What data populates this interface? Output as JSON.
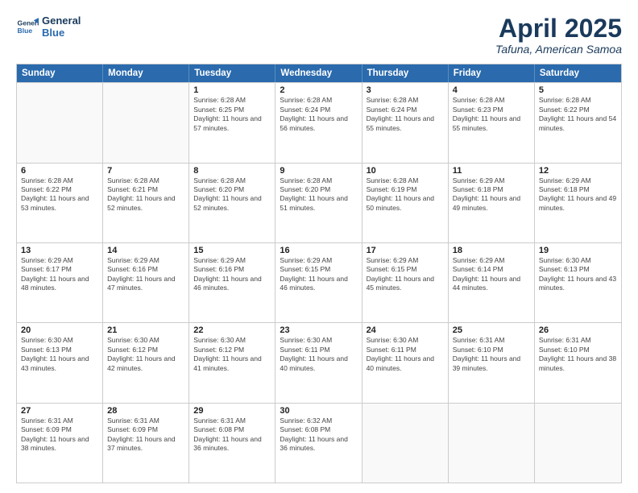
{
  "header": {
    "logo_line1": "General",
    "logo_line2": "Blue",
    "month_title": "April 2025",
    "location": "Tafuna, American Samoa"
  },
  "calendar": {
    "weekdays": [
      "Sunday",
      "Monday",
      "Tuesday",
      "Wednesday",
      "Thursday",
      "Friday",
      "Saturday"
    ],
    "rows": [
      [
        {
          "day": "",
          "empty": true
        },
        {
          "day": "",
          "empty": true
        },
        {
          "day": "1",
          "sunrise": "6:28 AM",
          "sunset": "6:25 PM",
          "daylight": "11 hours and 57 minutes."
        },
        {
          "day": "2",
          "sunrise": "6:28 AM",
          "sunset": "6:24 PM",
          "daylight": "11 hours and 56 minutes."
        },
        {
          "day": "3",
          "sunrise": "6:28 AM",
          "sunset": "6:24 PM",
          "daylight": "11 hours and 55 minutes."
        },
        {
          "day": "4",
          "sunrise": "6:28 AM",
          "sunset": "6:23 PM",
          "daylight": "11 hours and 55 minutes."
        },
        {
          "day": "5",
          "sunrise": "6:28 AM",
          "sunset": "6:22 PM",
          "daylight": "11 hours and 54 minutes."
        }
      ],
      [
        {
          "day": "6",
          "sunrise": "6:28 AM",
          "sunset": "6:22 PM",
          "daylight": "11 hours and 53 minutes."
        },
        {
          "day": "7",
          "sunrise": "6:28 AM",
          "sunset": "6:21 PM",
          "daylight": "11 hours and 52 minutes."
        },
        {
          "day": "8",
          "sunrise": "6:28 AM",
          "sunset": "6:20 PM",
          "daylight": "11 hours and 52 minutes."
        },
        {
          "day": "9",
          "sunrise": "6:28 AM",
          "sunset": "6:20 PM",
          "daylight": "11 hours and 51 minutes."
        },
        {
          "day": "10",
          "sunrise": "6:28 AM",
          "sunset": "6:19 PM",
          "daylight": "11 hours and 50 minutes."
        },
        {
          "day": "11",
          "sunrise": "6:29 AM",
          "sunset": "6:18 PM",
          "daylight": "11 hours and 49 minutes."
        },
        {
          "day": "12",
          "sunrise": "6:29 AM",
          "sunset": "6:18 PM",
          "daylight": "11 hours and 49 minutes."
        }
      ],
      [
        {
          "day": "13",
          "sunrise": "6:29 AM",
          "sunset": "6:17 PM",
          "daylight": "11 hours and 48 minutes."
        },
        {
          "day": "14",
          "sunrise": "6:29 AM",
          "sunset": "6:16 PM",
          "daylight": "11 hours and 47 minutes."
        },
        {
          "day": "15",
          "sunrise": "6:29 AM",
          "sunset": "6:16 PM",
          "daylight": "11 hours and 46 minutes."
        },
        {
          "day": "16",
          "sunrise": "6:29 AM",
          "sunset": "6:15 PM",
          "daylight": "11 hours and 46 minutes."
        },
        {
          "day": "17",
          "sunrise": "6:29 AM",
          "sunset": "6:15 PM",
          "daylight": "11 hours and 45 minutes."
        },
        {
          "day": "18",
          "sunrise": "6:29 AM",
          "sunset": "6:14 PM",
          "daylight": "11 hours and 44 minutes."
        },
        {
          "day": "19",
          "sunrise": "6:30 AM",
          "sunset": "6:13 PM",
          "daylight": "11 hours and 43 minutes."
        }
      ],
      [
        {
          "day": "20",
          "sunrise": "6:30 AM",
          "sunset": "6:13 PM",
          "daylight": "11 hours and 43 minutes."
        },
        {
          "day": "21",
          "sunrise": "6:30 AM",
          "sunset": "6:12 PM",
          "daylight": "11 hours and 42 minutes."
        },
        {
          "day": "22",
          "sunrise": "6:30 AM",
          "sunset": "6:12 PM",
          "daylight": "11 hours and 41 minutes."
        },
        {
          "day": "23",
          "sunrise": "6:30 AM",
          "sunset": "6:11 PM",
          "daylight": "11 hours and 40 minutes."
        },
        {
          "day": "24",
          "sunrise": "6:30 AM",
          "sunset": "6:11 PM",
          "daylight": "11 hours and 40 minutes."
        },
        {
          "day": "25",
          "sunrise": "6:31 AM",
          "sunset": "6:10 PM",
          "daylight": "11 hours and 39 minutes."
        },
        {
          "day": "26",
          "sunrise": "6:31 AM",
          "sunset": "6:10 PM",
          "daylight": "11 hours and 38 minutes."
        }
      ],
      [
        {
          "day": "27",
          "sunrise": "6:31 AM",
          "sunset": "6:09 PM",
          "daylight": "11 hours and 38 minutes."
        },
        {
          "day": "28",
          "sunrise": "6:31 AM",
          "sunset": "6:09 PM",
          "daylight": "11 hours and 37 minutes."
        },
        {
          "day": "29",
          "sunrise": "6:31 AM",
          "sunset": "6:08 PM",
          "daylight": "11 hours and 36 minutes."
        },
        {
          "day": "30",
          "sunrise": "6:32 AM",
          "sunset": "6:08 PM",
          "daylight": "11 hours and 36 minutes."
        },
        {
          "day": "",
          "empty": true
        },
        {
          "day": "",
          "empty": true
        },
        {
          "day": "",
          "empty": true
        }
      ]
    ]
  }
}
